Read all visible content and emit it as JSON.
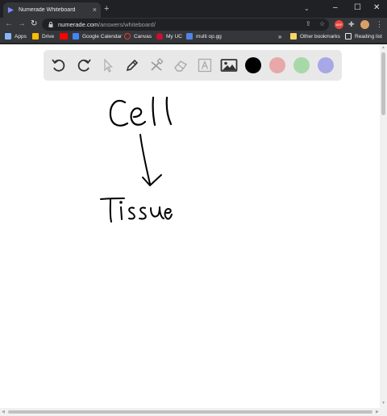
{
  "browser": {
    "tab_title": "Numerade Whiteboard",
    "url_host": "numerade.com",
    "url_path": "/answers/whiteboard/",
    "bookmarks": [
      {
        "label": "Apps",
        "color": "#8ab4f8"
      },
      {
        "label": "Drive",
        "color": "#fbbc04"
      },
      {
        "label": "",
        "color": "#ff0000"
      },
      {
        "label": "Google Calendar",
        "color": "#4285f4"
      },
      {
        "label": "Canvas",
        "color": "#e13f2b"
      },
      {
        "label": "My UC",
        "color": "#c8102e"
      },
      {
        "label": "multi op.gg",
        "color": "#5383e8"
      }
    ],
    "other_bookmarks": "Other bookmarks",
    "reading_list": "Reading list",
    "extension_badge": "ABP",
    "chevron": "»"
  },
  "whiteboard": {
    "tools": [
      "undo-icon",
      "redo-icon",
      "select-icon",
      "pen-icon",
      "tools-icon",
      "eraser-icon",
      "text-icon",
      "image-icon"
    ],
    "colors": [
      "#000000",
      "#e8a8a8",
      "#a8d8a8",
      "#a8a8e8"
    ],
    "handwriting": [
      "Cell",
      "Tissue"
    ]
  }
}
